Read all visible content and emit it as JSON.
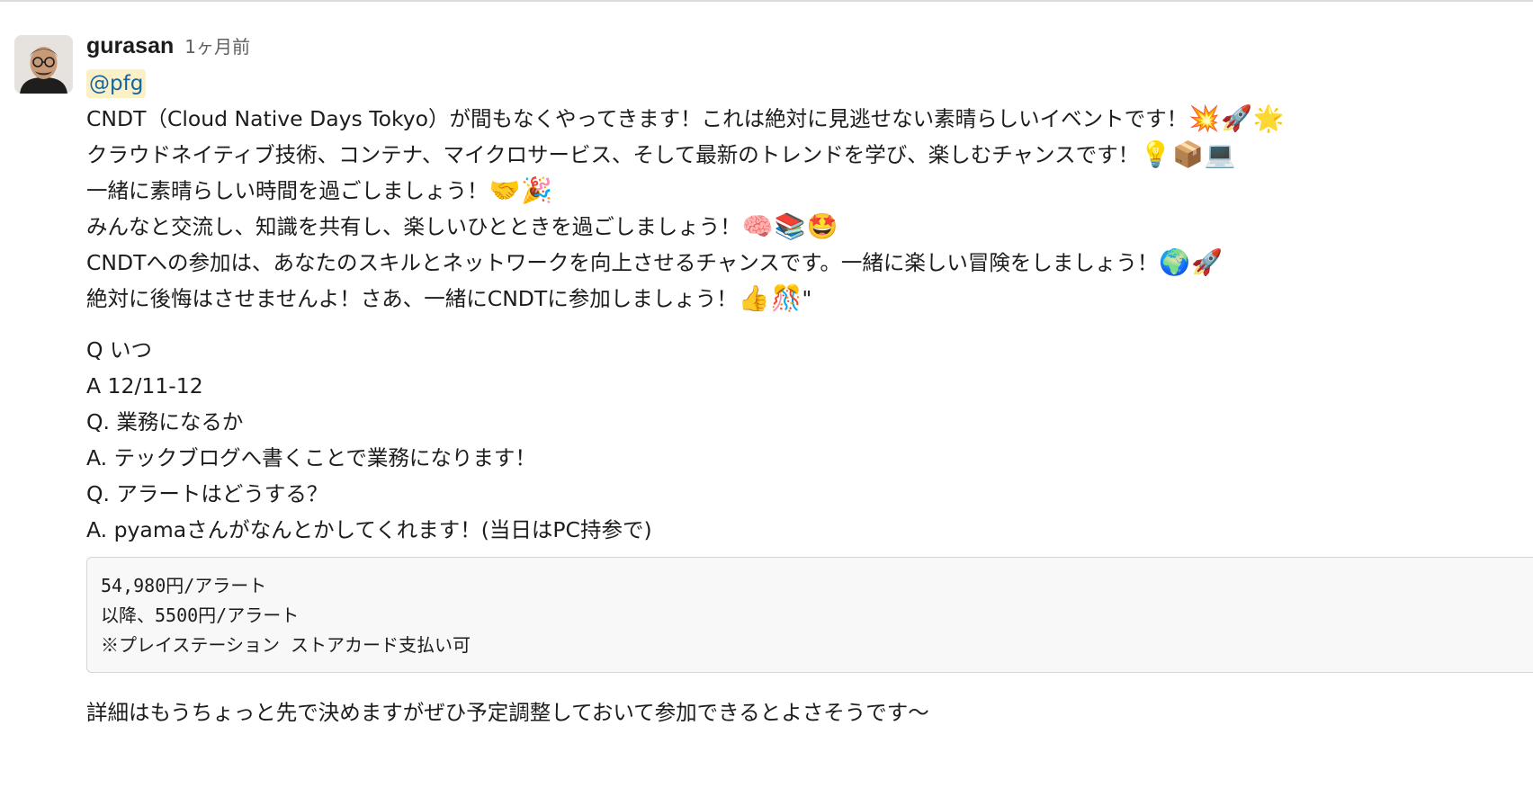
{
  "message": {
    "sender": "gurasan",
    "timestamp": "1ヶ月前",
    "mention": "@pfg",
    "body_lines": [
      {
        "text": "CNDT（Cloud Native Days Tokyo）が間もなくやってきます！これは絶対に見逃せない素晴らしいイベントです！",
        "emojis": [
          "💥",
          "🚀",
          "🌟"
        ],
        "emoji_names": [
          "collision-icon",
          "rocket-icon",
          "glowing-star-icon"
        ]
      },
      {
        "text": "クラウドネイティブ技術、コンテナ、マイクロサービス、そして最新のトレンドを学び、楽しむチャンスです！",
        "emojis": [
          "💡",
          "📦",
          "💻"
        ],
        "emoji_names": [
          "light-bulb-icon",
          "package-icon",
          "laptop-icon"
        ]
      },
      {
        "text": "一緒に素晴らしい時間を過ごしましょう！",
        "emojis": [
          "🤝",
          "🎉"
        ],
        "emoji_names": [
          "handshake-icon",
          "party-popper-icon"
        ]
      },
      {
        "text": "みんなと交流し、知識を共有し、楽しいひとときを過ごしましょう！",
        "emojis": [
          "🧠",
          "📚",
          "🤩"
        ],
        "emoji_names": [
          "brain-icon",
          "books-icon",
          "star-struck-icon"
        ]
      },
      {
        "text": "CNDTへの参加は、あなたのスキルとネットワークを向上させるチャンスです。一緒に楽しい冒険をしましょう！",
        "emojis": [
          "🌍",
          "🚀"
        ],
        "emoji_names": [
          "globe-icon",
          "rocket-icon"
        ]
      },
      {
        "text": "絶対に後悔はさせませんよ！さあ、一緒にCNDTに参加しましょう！",
        "emojis": [
          "👍",
          "🎊"
        ],
        "emoji_names": [
          "thumbs-up-icon",
          "confetti-ball-icon"
        ],
        "suffix": "\""
      }
    ],
    "qa_lines": [
      "Q いつ",
      "A 12/11-12",
      "Q. 業務になるか",
      "A. テックブログへ書くことで業務になります！",
      "Q. アラートはどうする？",
      "A.  pyamaさんがなんとかしてくれます！(当日はPC持参で)"
    ],
    "code_lines": [
      "54,980円/アラート",
      "以降、5500円/アラート",
      "※プレイステーション ストアカード支払い可"
    ],
    "footer": "詳細はもうちょっと先で決めますがぜひ予定調整しておいて参加できるとよさそうです〜"
  },
  "colors": {
    "mention_bg": "#fbf0c6",
    "mention_text": "#1264a3",
    "timestamp": "#616061",
    "code_bg": "#f8f8f8"
  }
}
